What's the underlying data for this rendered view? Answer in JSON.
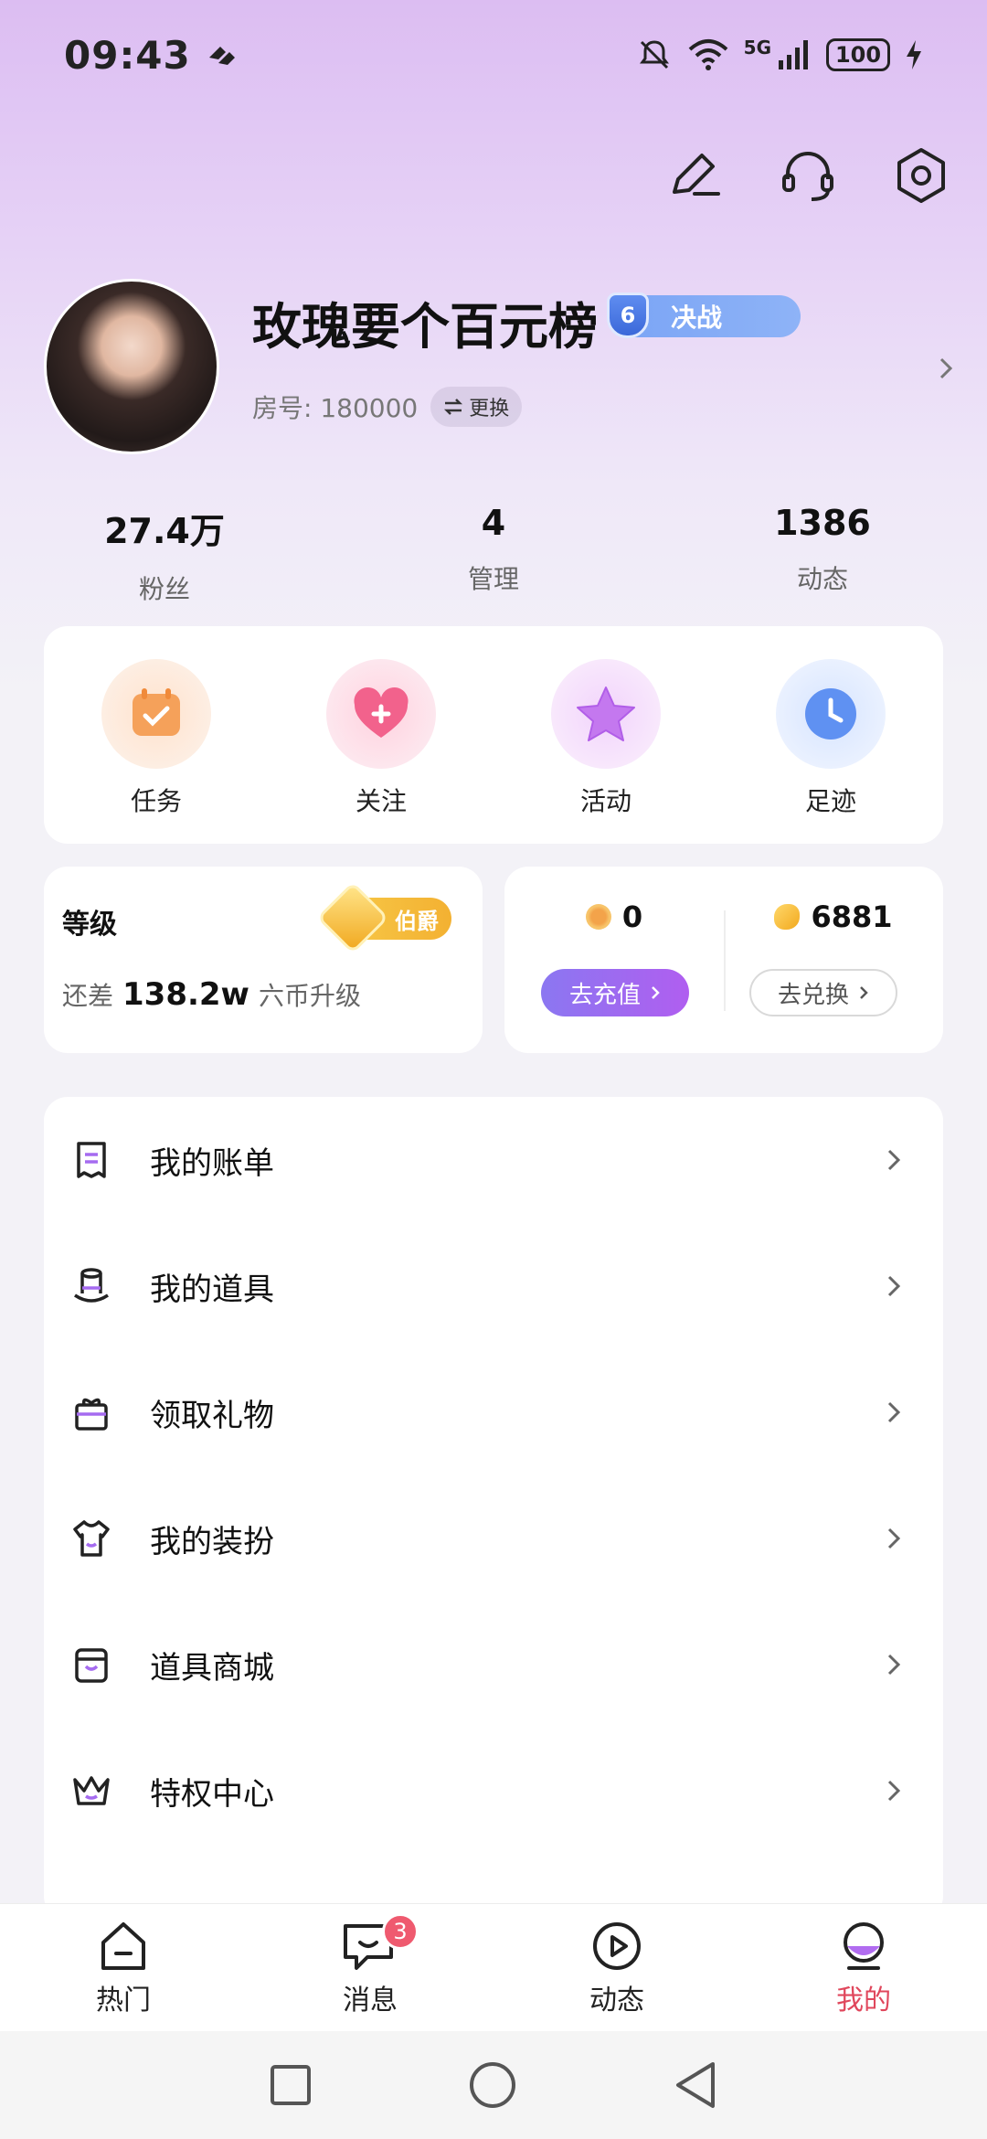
{
  "status_bar": {
    "time": "09:43",
    "network": "5G",
    "battery": "100"
  },
  "profile": {
    "name": "玫瑰要个百元榜",
    "level_number": "6",
    "level_name": "决战",
    "room_label": "房号: 180000",
    "swap_label": "更换"
  },
  "stats": [
    {
      "value": "27.4万",
      "label": "粉丝"
    },
    {
      "value": "4",
      "label": "管理"
    },
    {
      "value": "1386",
      "label": "动态"
    }
  ],
  "quick_actions": [
    {
      "label": "任务",
      "icon": "calendar-check-icon",
      "color": "#f7a35a"
    },
    {
      "label": "关注",
      "icon": "heart-plus-icon",
      "color": "#f0608a"
    },
    {
      "label": "活动",
      "icon": "star-icon",
      "color": "#c77af0"
    },
    {
      "label": "足迹",
      "icon": "clock-icon",
      "color": "#5d8ff2"
    }
  ],
  "level_card": {
    "title": "等级",
    "badge": "伯爵",
    "prefix": "还差",
    "amount": "138.2w",
    "suffix": "六币升级"
  },
  "wallet": {
    "coins": "0",
    "recharge_label": "去充值",
    "beans": "6881",
    "exchange_label": "去兑换"
  },
  "menu": [
    {
      "label": "我的账单",
      "icon": "bill-icon"
    },
    {
      "label": "我的道具",
      "icon": "hat-icon"
    },
    {
      "label": "领取礼物",
      "icon": "gift-icon"
    },
    {
      "label": "我的装扮",
      "icon": "shirt-icon"
    },
    {
      "label": "道具商城",
      "icon": "shop-icon"
    },
    {
      "label": "特权中心",
      "icon": "crown-icon"
    }
  ],
  "bottom_nav": [
    {
      "label": "热门",
      "icon": "home-icon"
    },
    {
      "label": "消息",
      "icon": "message-icon",
      "badge": "3"
    },
    {
      "label": "动态",
      "icon": "play-icon"
    },
    {
      "label": "我的",
      "icon": "profile-icon",
      "active": true
    }
  ],
  "colors": {
    "accent": "#e0475c",
    "primary_purple": "#9b6af1",
    "level_blue": "#7aa4f5",
    "gold": "#f3b132"
  }
}
